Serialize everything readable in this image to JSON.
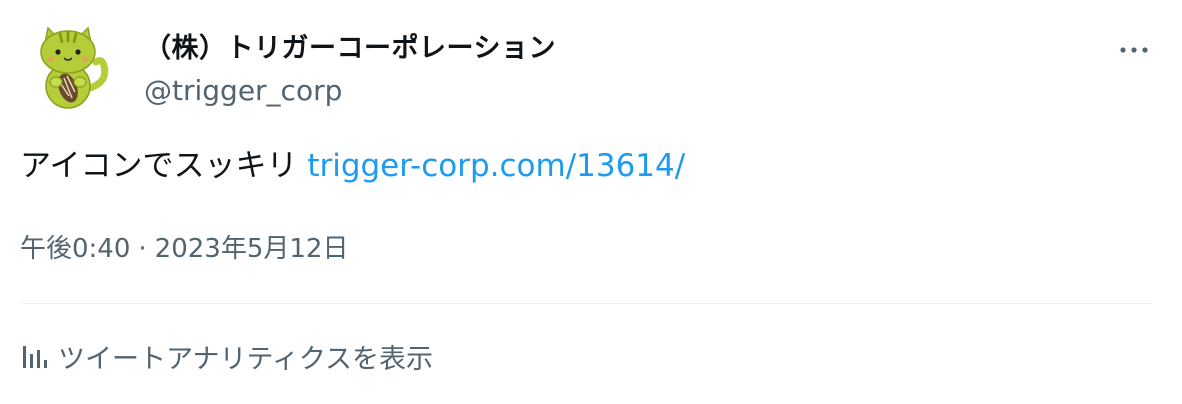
{
  "author": {
    "display_name": "（株）トリガーコーポレーション",
    "handle": "@trigger_corp",
    "avatar_icon": "cat-mascot-avatar-icon"
  },
  "tweet": {
    "text": "アイコンでスッキリ",
    "link_text": "trigger-corp.com/13614/",
    "time": "午後0:40",
    "separator": "·",
    "date": "2023年5月12日"
  },
  "actions": {
    "more_icon": "more-horizontal-icon",
    "analytics_icon": "bar-chart-icon",
    "analytics_label": "ツイートアナリティクスを表示"
  },
  "colors": {
    "link": "#1d9bf0",
    "secondary_text": "#536471",
    "primary_text": "#0f1419",
    "divider": "#eff3f4",
    "avatar_body": "#b5cd38"
  }
}
